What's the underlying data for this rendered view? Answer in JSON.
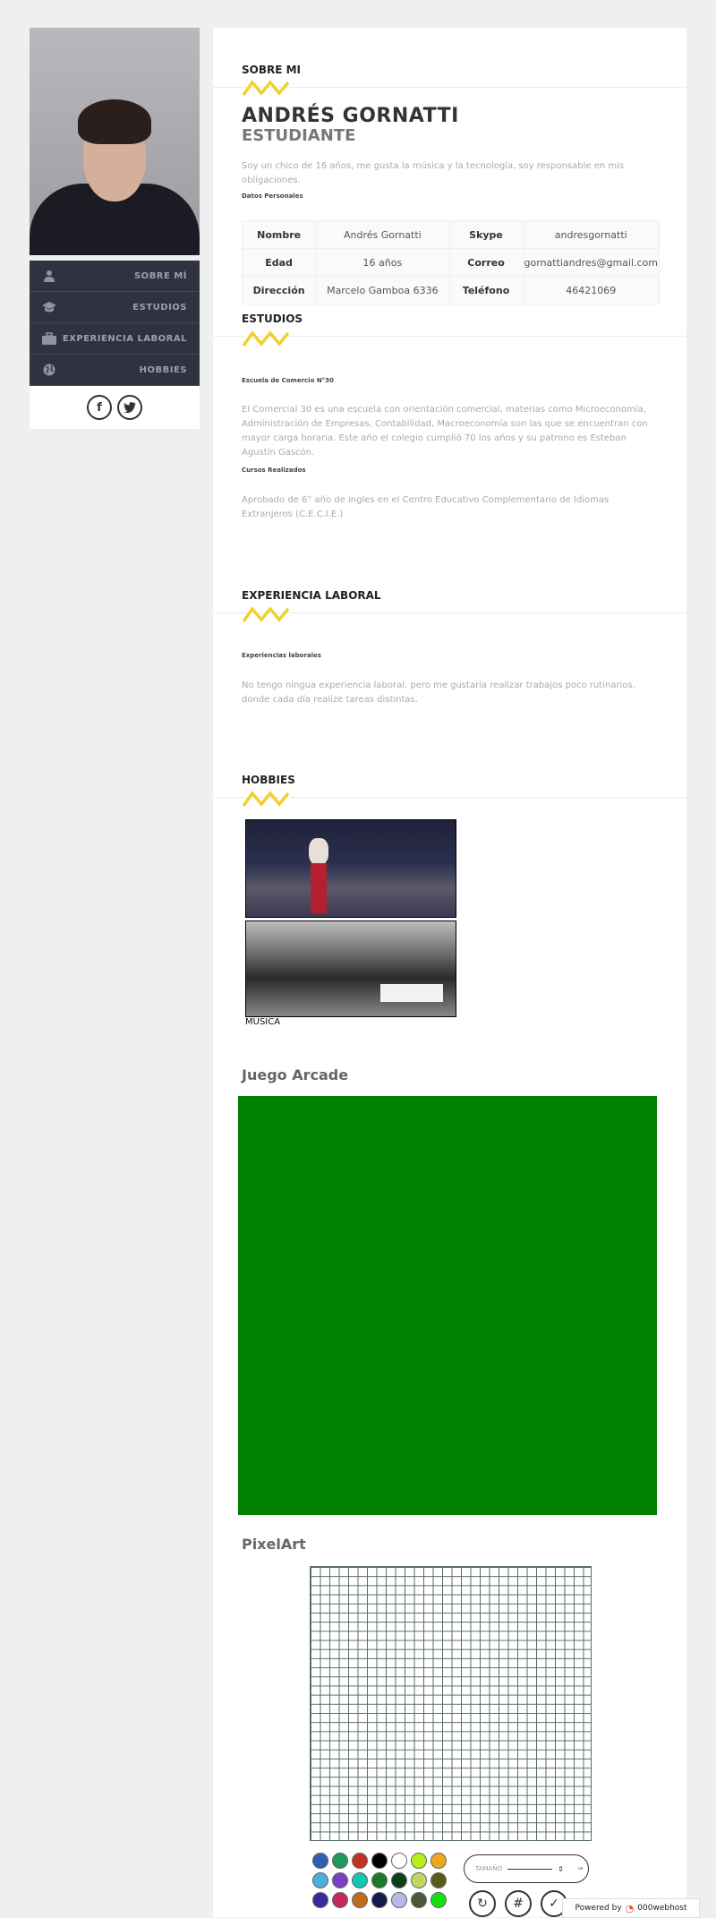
{
  "sidebar": {
    "nav": [
      {
        "label": "SOBRE MÍ",
        "icon": "user-icon"
      },
      {
        "label": "ESTUDIOS",
        "icon": "graduation-cap-icon"
      },
      {
        "label": "EXPERIENCIA LABORAL",
        "icon": "briefcase-icon"
      },
      {
        "label": "HOBBIES",
        "icon": "globe-icon"
      }
    ],
    "social": [
      {
        "glyph": "f",
        "icon": "facebook-icon"
      },
      {
        "glyph": "t",
        "icon": "twitter-icon"
      }
    ]
  },
  "about": {
    "title": "SOBRE MI",
    "name": "ANDRÉS GORNATTI",
    "role": "ESTUDIANTE",
    "intro": "Soy un chico de 16 años, me gusta la música y la tecnología, soy responsable en mis obligaciones.",
    "personal_title": "Datos Personales",
    "table": [
      [
        "Nombre",
        "Andrés Gornatti",
        "Skype",
        "andresgornatti"
      ],
      [
        "Edad",
        "16 años",
        "Correo",
        "gornattiandres@gmail.com"
      ],
      [
        "Dirección",
        "Marcelo Gamboa 6336",
        "Teléfono",
        "46421069"
      ]
    ]
  },
  "studies": {
    "title": "ESTUDIOS",
    "school": "Escuela de Comercio N°30",
    "school_desc": "El Comercial 30 es una escuela con orientación comercial, materias como Microeconomía, Administración de Empresas, Contabilidad, Macroeconomía son las que se encuentran con mayor carga horaria. Este año el colegio cumplió 70 los años y su patrono es Esteban Agustín Gascón.",
    "courses": "Cursos Realizados",
    "courses_desc": "Aprobado de 6° año de ingles en el Centro Educativo Complementario de Idiomas Extranjeros (C.E.C.I.E.)"
  },
  "experience": {
    "title": "EXPERIENCIA LABORAL",
    "subtitle": "Experiencias laborales",
    "desc": "No tengo ningua experiencia laboral, pero me gustaría realizar trabajos poco rutinarios, donde cada día realize tareas distintas."
  },
  "hobbies": {
    "title": "HOBBIES",
    "caption": "MÚSICA",
    "arcade_title": "Juego Arcade",
    "pixel_title": "PixelArt",
    "size_label": "TAMAÑO",
    "palette": [
      "#2e5fb0",
      "#1e9a5a",
      "#c2331f",
      "#000000",
      "#ffffff",
      "#b5f01a",
      "#f0a71b",
      "#4bb0de",
      "#7b3fc2",
      "#16c4b4",
      "#1a7a2a",
      "#0c3f18",
      "#c0d860",
      "#5a5a1a",
      "#3a2aa0",
      "#c2285a",
      "#c26a20",
      "#141a4a",
      "#b8b8e8",
      "#4a5a38",
      "#12e012"
    ]
  },
  "footer": {
    "powered": "Powered by",
    "brand": "000webhost"
  }
}
